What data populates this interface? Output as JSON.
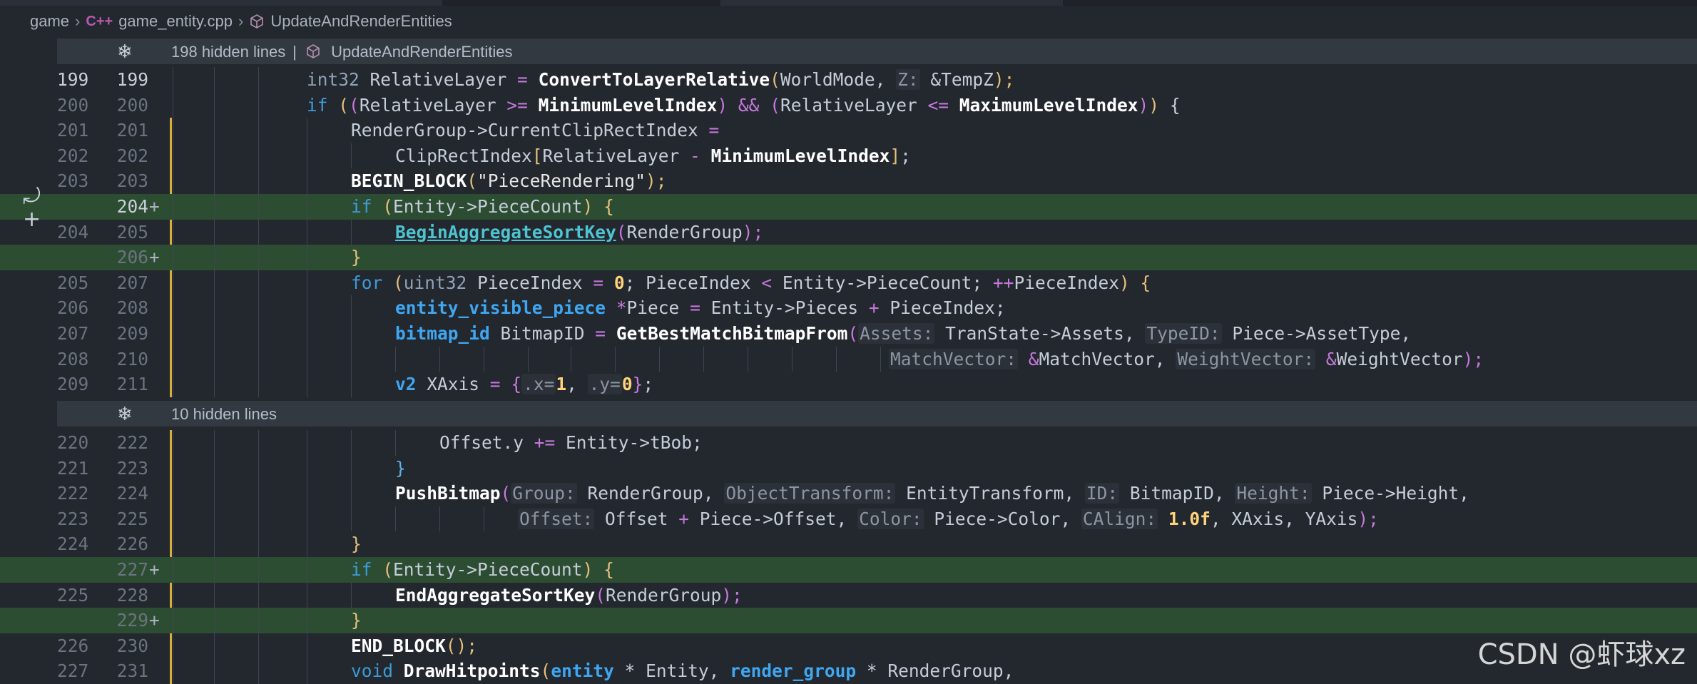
{
  "breadcrumb": {
    "folder": "game",
    "file_badge": "C++",
    "file": "game_entity.cpp",
    "symbol": "UpdateAndRenderEntities"
  },
  "folds": [
    {
      "count_text": "198 hidden lines",
      "separator": "|",
      "symbol": "UpdateAndRenderEntities"
    },
    {
      "count_text": "10 hidden lines"
    }
  ],
  "lines": [
    {
      "old": "199",
      "new": "199"
    },
    {
      "old": "200",
      "new": "200"
    },
    {
      "old": "201",
      "new": "201"
    },
    {
      "old": "202",
      "new": "202"
    },
    {
      "old": "203",
      "new": "203"
    },
    {
      "old": "",
      "new": "204+"
    },
    {
      "old": "204",
      "new": "205"
    },
    {
      "old": "",
      "new": "206+"
    },
    {
      "old": "205",
      "new": "207"
    },
    {
      "old": "206",
      "new": "208"
    },
    {
      "old": "207",
      "new": "209"
    },
    {
      "old": "208",
      "new": "210"
    },
    {
      "old": "209",
      "new": "211"
    },
    {
      "old": "220",
      "new": "222"
    },
    {
      "old": "221",
      "new": "223"
    },
    {
      "old": "222",
      "new": "224"
    },
    {
      "old": "223",
      "new": "225"
    },
    {
      "old": "224",
      "new": "226"
    },
    {
      "old": "",
      "new": "227+"
    },
    {
      "old": "225",
      "new": "228"
    },
    {
      "old": "",
      "new": "229+"
    },
    {
      "old": "226",
      "new": "230"
    },
    {
      "old": "227",
      "new": "231"
    }
  ],
  "code": {
    "l199": [
      "int32",
      " RelativeLayer ",
      "=",
      " ",
      "ConvertToLayerRelative",
      "(",
      "WorldMode, ",
      "Z:",
      " &TempZ",
      ");"
    ],
    "l200": [
      "if",
      " ",
      "(",
      "(",
      "RelativeLayer ",
      ">=",
      " ",
      "MinimumLevelIndex",
      ")",
      " ",
      "&&",
      " ",
      "(",
      "RelativeLayer ",
      "<=",
      " ",
      "MaximumLevelIndex",
      ")",
      ")",
      " ",
      "{"
    ],
    "l201": [
      "RenderGroup->CurrentClipRectIndex ",
      "="
    ],
    "l202": [
      "ClipRectIndex",
      "[",
      "RelativeLayer ",
      "-",
      " ",
      "MinimumLevelIndex",
      "]",
      ";"
    ],
    "l203": [
      "BEGIN_BLOCK",
      "(",
      "\"PieceRendering\"",
      ");"
    ],
    "l204": [
      "if",
      " ",
      "(",
      "Entity->PieceCount",
      ")",
      " ",
      "{"
    ],
    "l205": [
      "BeginAggregateSortKey",
      "(",
      "RenderGroup",
      ");"
    ],
    "l206": [
      "}"
    ],
    "l207": [
      "for",
      " ",
      "(",
      "uint32",
      " PieceIndex ",
      "=",
      " ",
      "0",
      "; PieceIndex ",
      "<",
      " Entity->PieceCount; ",
      "++",
      "PieceIndex",
      ")",
      " ",
      "{"
    ],
    "l208": [
      "entity_visible_piece",
      " ",
      "*",
      "Piece ",
      "=",
      " Entity->Pieces ",
      "+",
      " PieceIndex;"
    ],
    "l209": [
      "bitmap_id",
      " BitmapID ",
      "=",
      " ",
      "GetBestMatchBitmapFrom",
      "(",
      "Assets:",
      " TranState->Assets, ",
      "TypeID:",
      " Piece->AssetType,"
    ],
    "l210": [
      "MatchVector:",
      " ",
      "&",
      "MatchVector, ",
      "WeightVector:",
      " ",
      "&",
      "WeightVector",
      ");"
    ],
    "l211": [
      "v2",
      " XAxis ",
      "=",
      " ",
      "{",
      ".x=",
      "1",
      ", ",
      ".y=",
      "0",
      "}",
      ";"
    ],
    "l222": [
      "Offset.y ",
      "+=",
      " Entity->tBob;"
    ],
    "l223": [
      "}"
    ],
    "l224": [
      "PushBitmap",
      "(",
      "Group:",
      " RenderGroup, ",
      "ObjectTransform:",
      " EntityTransform, ",
      "ID:",
      " BitmapID, ",
      "Height:",
      " Piece->Height,"
    ],
    "l225": [
      "Offset:",
      " Offset ",
      "+",
      " Piece->Offset, ",
      "Color:",
      " Piece->Color, ",
      "CAlign:",
      " ",
      "1.0f",
      ", XAxis, YAxis",
      ");"
    ],
    "l226": [
      "}"
    ],
    "l227": [
      "if",
      " ",
      "(",
      "Entity->PieceCount",
      ")",
      " ",
      "{"
    ],
    "l228": [
      "EndAggregateSortKey",
      "(",
      "RenderGroup",
      ");"
    ],
    "l229": [
      "}"
    ],
    "l230": [
      "END_BLOCK",
      "(",
      ");"
    ],
    "l231": [
      "void",
      " ",
      "DrawHitpoints",
      "(",
      "entity",
      " * Entity, ",
      "render_group",
      " * RenderGroup,"
    ]
  },
  "gutter": {
    "revert_icon": "undo-arrow-icon",
    "add_icon": "plus-icon"
  },
  "watermark": "CSDN @虾球xz",
  "colors": {
    "background": "#23272e",
    "added_line": "#2d4d33",
    "modified_bar": "#d4b03a",
    "fold_bg": "#333941",
    "keyword": "#3d9bd9",
    "function": "#ffffff",
    "number": "#ffd37a"
  }
}
